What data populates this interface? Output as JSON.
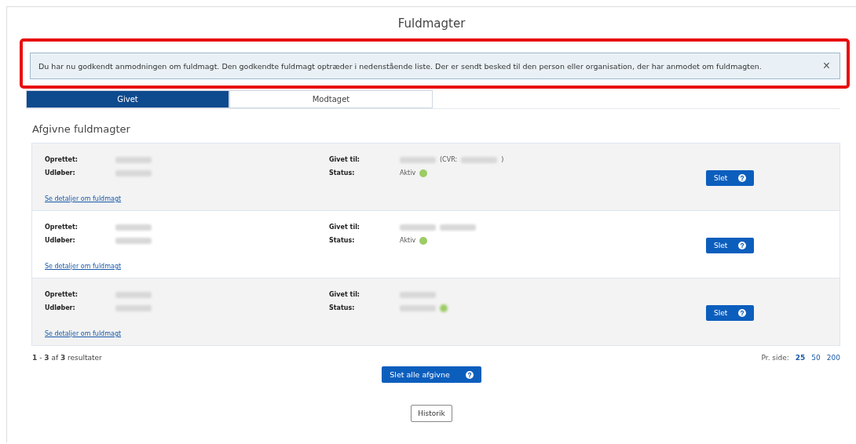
{
  "page_title": "Fuldmagter",
  "alert": {
    "text": "Du har nu godkendt anmodningen om fuldmagt. Den godkendte fuldmagt optræder i nedenstående liste. Der er sendt besked til den person eller organisation, der har anmodet om fuldmagten.",
    "close": "×",
    "highlighted": true
  },
  "tabs": [
    {
      "label": "Givet",
      "selected": true
    },
    {
      "label": "Modtaget",
      "selected": false
    }
  ],
  "section_title": "Afgivne fuldmagter",
  "rows": [
    {
      "created_label": "Oprettet:",
      "created": [
        {
          "kind": "redacted"
        }
      ],
      "expires_label": "Udløber:",
      "expires": [
        {
          "kind": "redacted"
        }
      ],
      "given_to_label": "Givet til:",
      "given_to": [
        {
          "kind": "redacted"
        },
        {
          "kind": "text",
          "text": "(CVR:"
        },
        {
          "kind": "redacted"
        },
        {
          "kind": "text",
          "text": ")"
        }
      ],
      "status_label": "Status:",
      "status": {
        "kind": "text",
        "text": "Aktiv",
        "color": "#9ccc65"
      },
      "details_link": "Se detaljer om fuldmagt",
      "delete": "Slet"
    },
    {
      "created_label": "Oprettet:",
      "created": [
        {
          "kind": "redacted"
        }
      ],
      "expires_label": "Udløber:",
      "expires": [
        {
          "kind": "redacted"
        }
      ],
      "given_to_label": "Givet til:",
      "given_to": [
        {
          "kind": "redacted"
        },
        {
          "kind": "redacted"
        }
      ],
      "status_label": "Status:",
      "status": {
        "kind": "text",
        "text": "Aktiv",
        "color": "#9ccc65"
      },
      "details_link": "Se detaljer om fuldmagt",
      "delete": "Slet"
    },
    {
      "created_label": "Oprettet:",
      "created": [
        {
          "kind": "redacted"
        }
      ],
      "expires_label": "Udløber:",
      "expires": [
        {
          "kind": "redacted"
        }
      ],
      "given_to_label": "Givet til:",
      "given_to": [
        {
          "kind": "redacted"
        }
      ],
      "status_label": "Status:",
      "status": {
        "kind": "redacted",
        "color": "#9ccc65"
      },
      "details_link": "Se detaljer om fuldmagt",
      "delete": "Slet"
    }
  ],
  "result_summary": "**1** - **3** af **3** resultater",
  "per_page": {
    "label": "Pr. side:",
    "options": [
      {
        "label": "25",
        "selected": true
      },
      {
        "label": "50",
        "selected": false
      },
      {
        "label": "200",
        "selected": false
      }
    ]
  },
  "delete_all": "Slet alle afgivne",
  "history": "Historik"
}
